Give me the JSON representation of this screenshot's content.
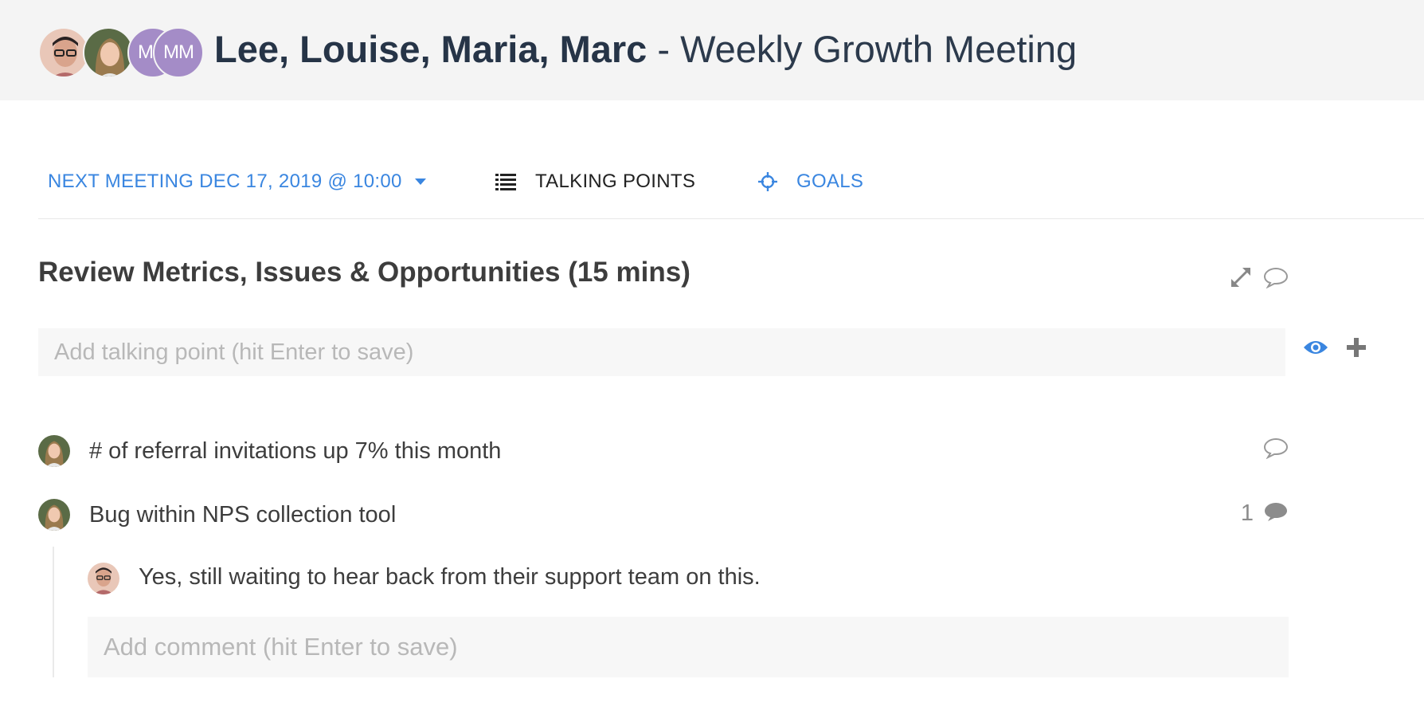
{
  "header": {
    "participants": [
      {
        "name": "Lee",
        "type": "photo"
      },
      {
        "name": "Louise",
        "type": "photo"
      },
      {
        "name": "Maria",
        "type": "initials",
        "initials": "MM"
      },
      {
        "name": "Marc",
        "type": "initials",
        "initials": "MM"
      }
    ],
    "title_names": "Lee, Louise, Maria, Marc",
    "title_separator": " - ",
    "title_meeting": "Weekly Growth Meeting"
  },
  "nav": {
    "next_meeting": "NEXT MEETING DEC 17, 2019 @ 10:00",
    "talking_points": "TALKING POINTS",
    "goals": "GOALS"
  },
  "section": {
    "title": "Review Metrics, Issues & Opportunities (15 mins)",
    "talking_point_placeholder": "Add talking point (hit Enter to save)"
  },
  "items": [
    {
      "text": "# of referral invitations up 7% this month",
      "comment_count": ""
    },
    {
      "text": "Bug within NPS collection tool",
      "comment_count": "1"
    }
  ],
  "reply": {
    "text": "Yes, still waiting to hear back from their support team on this."
  },
  "comment_placeholder": "Add comment (hit Enter to save)",
  "colors": {
    "accent": "#3a86e0",
    "initials_avatar": "#a48cc7",
    "header_bg": "#f4f4f4"
  }
}
